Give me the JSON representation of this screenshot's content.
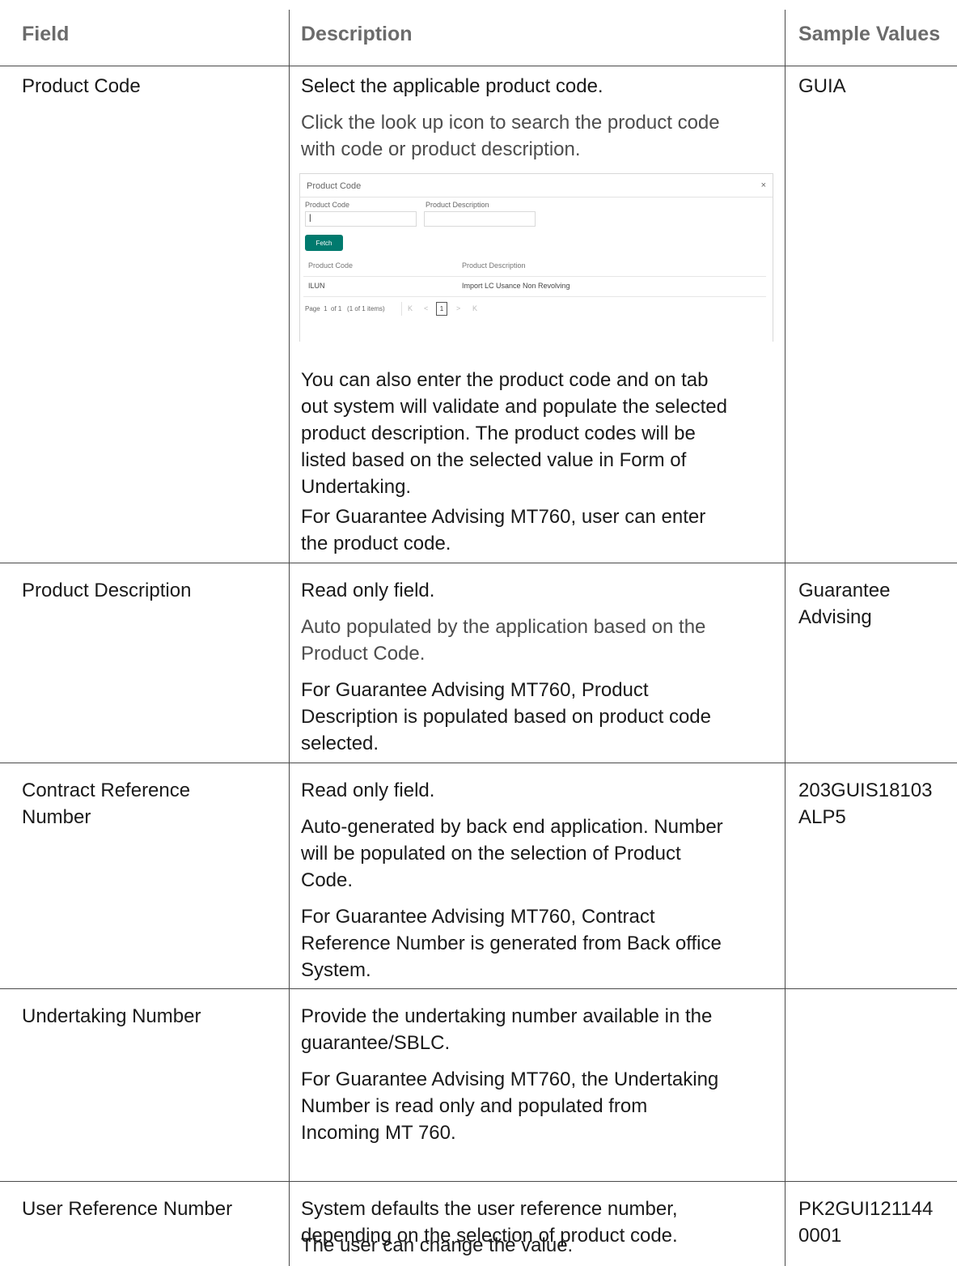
{
  "table": {
    "headers": {
      "field": "Field",
      "description": "Description",
      "sample": "Sample Values"
    },
    "rows": [
      {
        "field": "Product Code",
        "desc_1": "Select the applicable product code.",
        "desc_2_lines": [
          "Click the look up icon to search the product code",
          "with code or product description."
        ],
        "desc_3_lines": [
          "You can also enter the product code and on tab",
          "out system will validate and populate the selected",
          "product description. The product codes will be",
          "listed based on the selected value in Form of",
          "Undertaking."
        ],
        "desc_4_lines": [
          "For Guarantee Advising MT760, user can enter",
          "the product code."
        ],
        "sample": "GUIA"
      },
      {
        "field": "Product Description",
        "desc_1": "Read only field.",
        "desc_2_lines": [
          "Auto populated by the application based on the",
          "Product Code."
        ],
        "desc_3_lines": [
          "For Guarantee Advising MT760, Product",
          "Description is populated based on product code",
          "selected."
        ],
        "sample_lines": [
          "Guarantee",
          "Advising"
        ]
      },
      {
        "field_lines": [
          "Contract Reference",
          "Number"
        ],
        "desc_1": "Read only field.",
        "desc_2_lines": [
          "Auto-generated by back end application. Number",
          "will be populated on the selection of Product",
          "Code."
        ],
        "desc_3_lines": [
          "For Guarantee Advising MT760, Contract",
          "Reference Number is generated from Back office",
          "System."
        ],
        "sample_lines": [
          "203GUIS18103",
          "ALP5"
        ]
      },
      {
        "field": "Undertaking Number",
        "desc_1_lines": [
          "Provide the undertaking number available in the",
          "guarantee/SBLC."
        ],
        "desc_2_lines": [
          "For Guarantee Advising MT760, the Undertaking",
          "Number is read only and populated from",
          "Incoming MT 760."
        ]
      },
      {
        "field": "User Reference Number",
        "desc_1_lines": [
          "System defaults the user reference number,",
          "depending on the selection of product code."
        ],
        "desc_2": "The user can change the value.",
        "sample_lines": [
          "PK2GUI121144",
          "0001"
        ]
      }
    ]
  },
  "dialog": {
    "title": "Product Code",
    "close": "×",
    "code_label": "Product Code",
    "code_value": "|",
    "desc_label": "Product Description",
    "desc_value": "",
    "fetch_label": "Fetch",
    "col_code": "Product Code",
    "col_desc": "Product Description",
    "result_code": "ILUN",
    "result_desc": "Import LC Usance Non Revolving",
    "page_info": "Page  1  of 1   (1 of 1 items)",
    "first": "K",
    "prev": "<",
    "page_num": "1",
    "next": ">",
    "last": "K"
  }
}
